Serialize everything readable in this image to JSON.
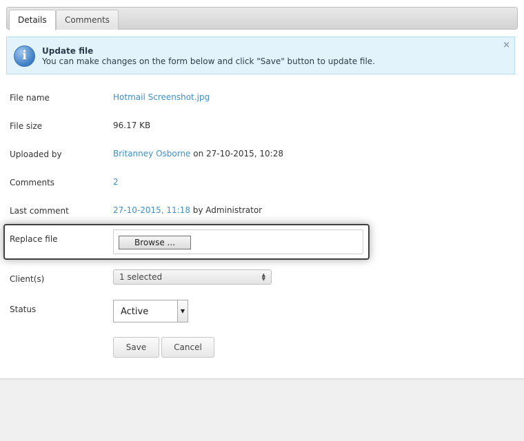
{
  "tabs": {
    "details": "Details",
    "comments": "Comments"
  },
  "notice": {
    "icon": "info-icon",
    "title": "Update file",
    "text": "You can make changes on the form below and click \"Save\" button to update file.",
    "close": "×"
  },
  "form": {
    "file_name": {
      "label": "File name",
      "value": "Hotmail Screenshot.jpg"
    },
    "file_size": {
      "label": "File size",
      "value": "96.17 KB"
    },
    "uploaded_by": {
      "label": "Uploaded by",
      "user": "Britanney Osborne",
      "suffix": " on 27-10-2015, 10:28"
    },
    "comments": {
      "label": "Comments",
      "value": "2"
    },
    "last_comment": {
      "label": "Last comment",
      "date": "27-10-2015, 11:18",
      "suffix": " by Administrator"
    },
    "replace_file": {
      "label": "Replace file",
      "browse": "Browse ..."
    },
    "clients": {
      "label": "Client(s)",
      "value": "1 selected"
    },
    "status": {
      "label": "Status",
      "value": "Active"
    }
  },
  "buttons": {
    "save": "Save",
    "cancel": "Cancel"
  },
  "colors": {
    "link": "#3f8fc8",
    "notice_bg": "#e3f3fb",
    "notice_border": "#b6dcee"
  }
}
